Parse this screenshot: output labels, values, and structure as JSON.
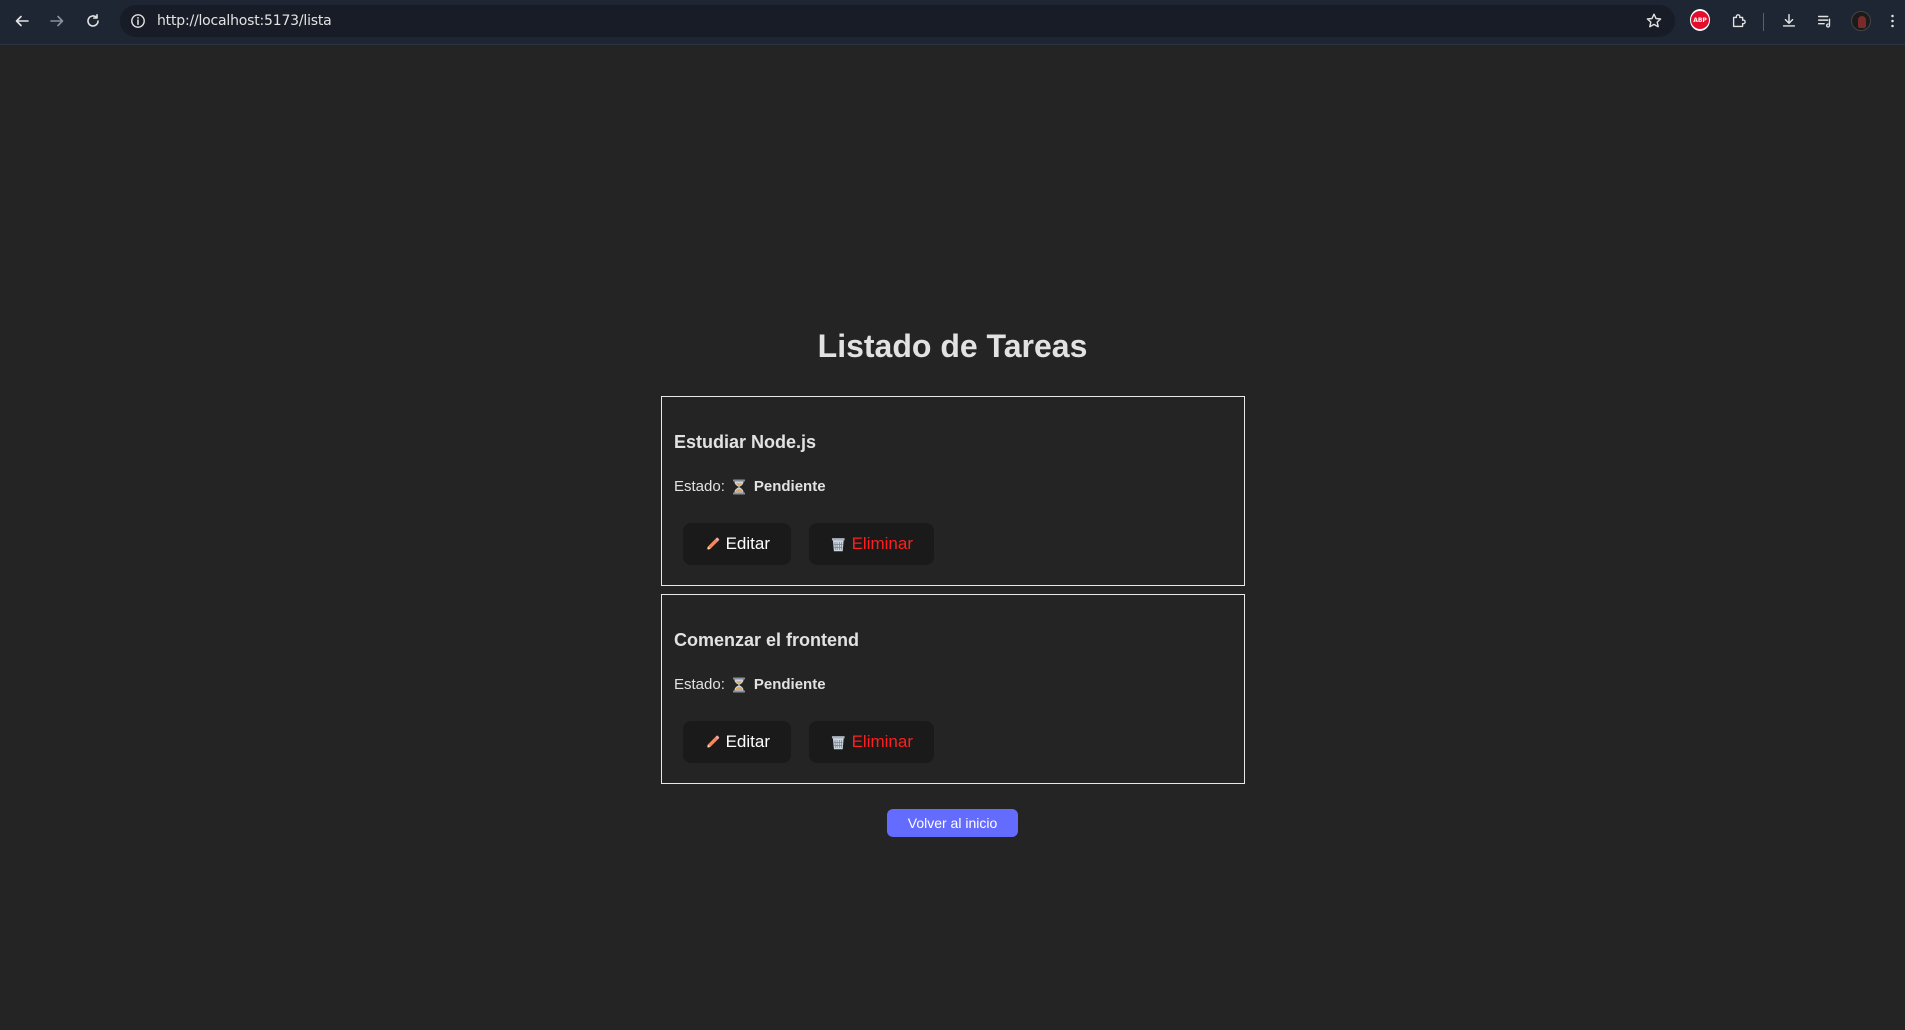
{
  "browser": {
    "url": "http://localhost:5173/lista",
    "icons": [
      "back-icon",
      "forward-icon",
      "reload-icon",
      "site-info-icon",
      "bookmark-star-icon",
      "adblock-extension-icon",
      "extensions-puzzle-icon",
      "download-icon",
      "reading-list-icon",
      "profile-avatar",
      "menu-kebab-icon"
    ],
    "adblock_label": "ABP"
  },
  "page": {
    "title": "Listado de Tareas",
    "tasks": [
      {
        "title": "Estudiar Node.js",
        "status_label": "Estado:",
        "status_icon": "hourglass-icon",
        "status_value": "Pendiente",
        "edit_label": "Editar",
        "delete_label": "Eliminar"
      },
      {
        "title": "Comenzar el frontend",
        "status_label": "Estado:",
        "status_icon": "hourglass-icon",
        "status_value": "Pendiente",
        "edit_label": "Editar",
        "delete_label": "Eliminar"
      }
    ],
    "back_button": "Volver al inicio"
  },
  "colors": {
    "background": "#242424",
    "accent": "#646cff",
    "delete_text": "#ff1f1f",
    "button_bg": "#1a1a1a",
    "card_border": "#e8e8e8",
    "chrome_bg": "#1f2633"
  }
}
